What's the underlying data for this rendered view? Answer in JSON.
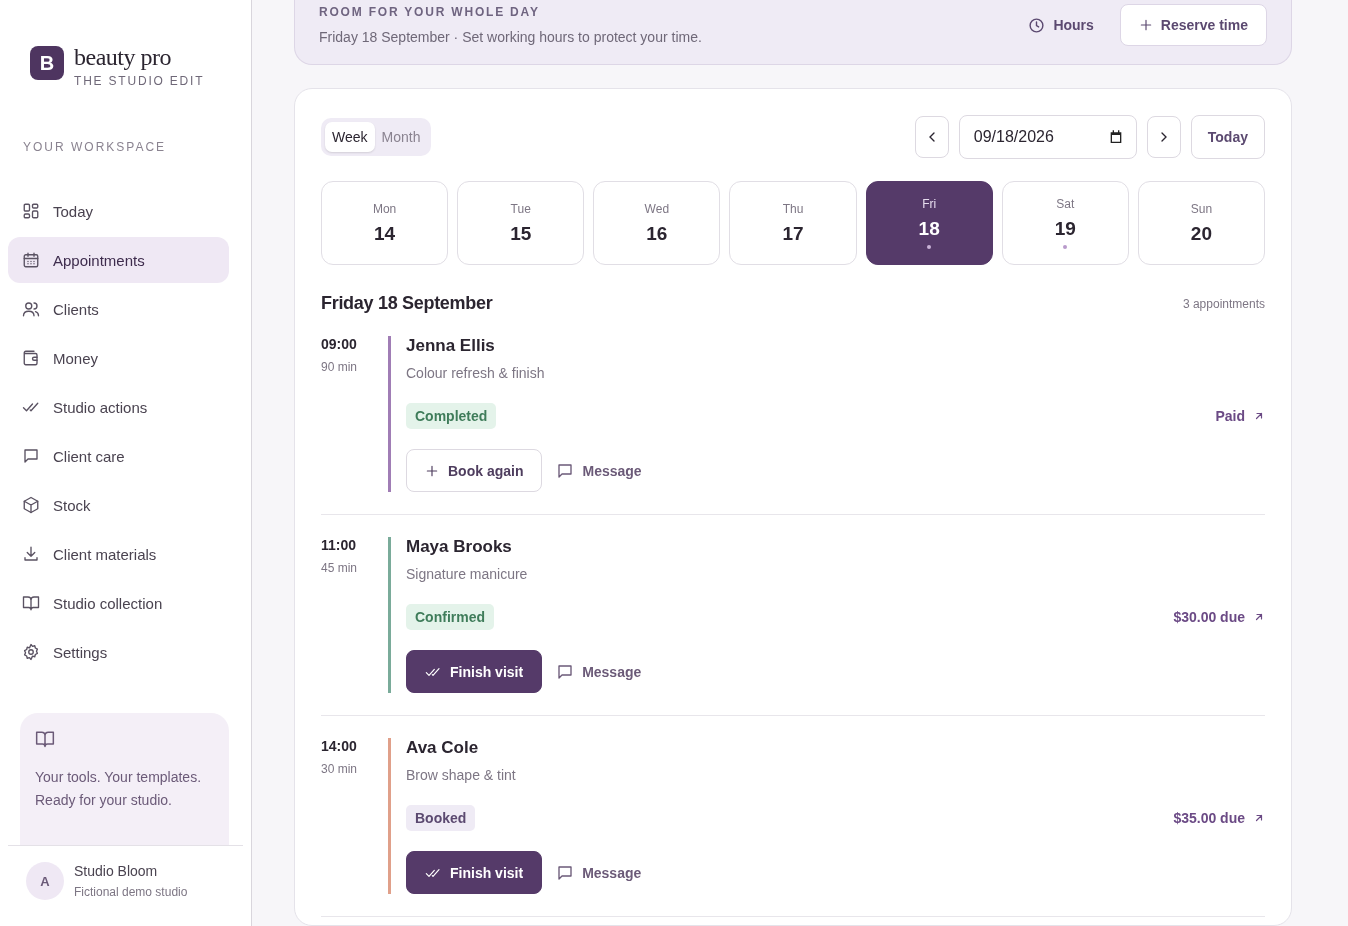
{
  "sidebar": {
    "brand": {
      "logo_letter": "B",
      "name": "beauty pro",
      "tagline": "THE STUDIO EDIT"
    },
    "section_label": "YOUR WORKSPACE",
    "items": [
      {
        "label": "Today",
        "selected": false
      },
      {
        "label": "Appointments",
        "selected": true
      },
      {
        "label": "Clients",
        "selected": false
      },
      {
        "label": "Money",
        "selected": false
      },
      {
        "label": "Studio actions",
        "selected": false
      },
      {
        "label": "Client care",
        "selected": false
      },
      {
        "label": "Stock",
        "selected": false
      },
      {
        "label": "Client materials",
        "selected": false
      },
      {
        "label": "Studio collection",
        "selected": false
      },
      {
        "label": "Settings",
        "selected": false
      }
    ],
    "promo": {
      "text": "Your tools. Your templates. Ready for your studio."
    },
    "user": {
      "initial": "A",
      "name": "Studio Bloom",
      "subtitle": "Fictional demo studio"
    }
  },
  "banner": {
    "eyebrow": "ROOM FOR YOUR WHOLE DAY",
    "text": "Friday 18 September · Set working hours to protect your time.",
    "hours_button": "Hours",
    "reserve_button": "Reserve time"
  },
  "calendar": {
    "views": [
      {
        "label": "Week",
        "selected": true
      },
      {
        "label": "Month",
        "selected": false
      }
    ],
    "date_value": "09/18/2026",
    "today_button": "Today",
    "days": [
      {
        "weekday": "Mon",
        "date": "14",
        "selected": false,
        "dot": false
      },
      {
        "weekday": "Tue",
        "date": "15",
        "selected": false,
        "dot": false
      },
      {
        "weekday": "Wed",
        "date": "16",
        "selected": false,
        "dot": false
      },
      {
        "weekday": "Thu",
        "date": "17",
        "selected": false,
        "dot": false
      },
      {
        "weekday": "Fri",
        "date": "18",
        "selected": true,
        "dot": true
      },
      {
        "weekday": "Sat",
        "date": "19",
        "selected": false,
        "dot": true
      },
      {
        "weekday": "Sun",
        "date": "20",
        "selected": false,
        "dot": false
      }
    ],
    "day_title": "Friday 18 September",
    "count": "3 appointments",
    "appointments": [
      {
        "time": "09:00",
        "duration": "90 min",
        "client": "Jenna Ellis",
        "service": "Colour refresh & finish",
        "color": "#a07db5",
        "status": {
          "kind": "completed",
          "label": "Completed"
        },
        "payment": "Paid",
        "action": {
          "kind": "book",
          "label": "Book again"
        },
        "message": "Message"
      },
      {
        "time": "11:00",
        "duration": "45 min",
        "client": "Maya Brooks",
        "service": "Signature manicure",
        "color": "#7aab9a",
        "status": {
          "kind": "confirmed",
          "label": "Confirmed"
        },
        "payment": "$30.00 due",
        "action": {
          "kind": "finish",
          "label": "Finish visit"
        },
        "message": "Message"
      },
      {
        "time": "14:00",
        "duration": "30 min",
        "client": "Ava Cole",
        "service": "Brow shape & tint",
        "color": "#e0a08a",
        "status": {
          "kind": "booked",
          "label": "Booked"
        },
        "payment": "$35.00 due",
        "action": {
          "kind": "finish",
          "label": "Finish visit"
        },
        "message": "Message"
      }
    ]
  }
}
